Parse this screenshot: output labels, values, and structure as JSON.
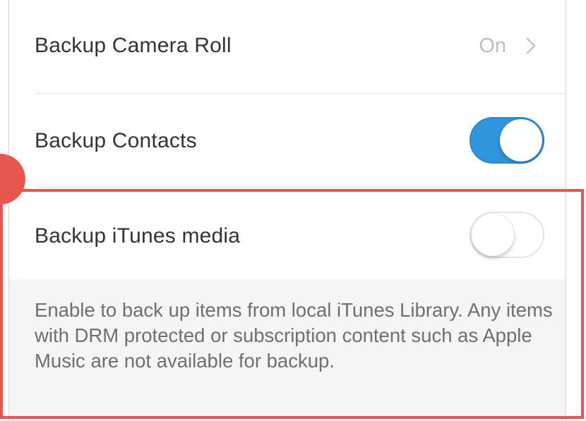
{
  "settings": {
    "camera_roll": {
      "label": "Backup Camera Roll",
      "value": "On"
    },
    "contacts": {
      "label": "Backup Contacts",
      "enabled": true
    },
    "itunes_media": {
      "label": "Backup iTunes media",
      "enabled": false,
      "footer": "Enable to back up items from local iTunes Library. Any items with DRM protected or subscription content such as Apple Music are not available for backup."
    }
  },
  "icons": {
    "disclosure": "chevron-right-icon"
  },
  "colors": {
    "toggle_on": "#2f95dc",
    "highlight": "#e85550",
    "value_text": "#bdbdbd",
    "footer_background": "#f5f5f5"
  }
}
